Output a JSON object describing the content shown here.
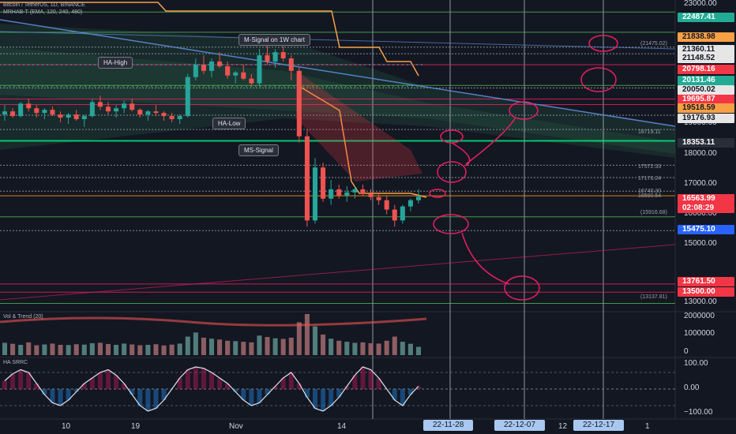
{
  "main_pane": {
    "symbol_line": "Bitcoin / TetherUS, 1D, BINANCE",
    "indicator_line": "MRHAB-T (EMA, 120, 240, 480)"
  },
  "vol_pane": {
    "title": "Vol & Trend (20)"
  },
  "osc_pane": {
    "title": "HA SRRC"
  },
  "annotations": {
    "m_signal": "M-Signal on 1W chart",
    "ha_high": "HA-High",
    "ha_low": "HA-Low",
    "ms_signal": "MS-Signal"
  },
  "line_labels": [
    {
      "text": "(21475.02)"
    },
    {
      "text": "18719.11"
    },
    {
      "text": "17572.33"
    },
    {
      "text": "17176.24"
    },
    {
      "text": "16740.30"
    },
    {
      "text": "16590.54"
    },
    {
      "text": "(15916.68)"
    },
    {
      "text": "(13137.81)"
    }
  ],
  "price_axis": {
    "ticks": [
      "23000.00",
      "19000.00",
      "18000.00",
      "17000.00",
      "16000.00",
      "15000.00",
      "13000.00"
    ],
    "badges": [
      {
        "text": "22487.41",
        "bg": "#22ab94",
        "fg": "#ffffff"
      },
      {
        "text": "21838.98",
        "bg": "#f7a046",
        "fg": "#131722"
      },
      {
        "text": "21360.11",
        "bg": "#e6e6e6",
        "fg": "#131722"
      },
      {
        "text": "21148.52",
        "bg": "#e6e6e6",
        "fg": "#131722"
      },
      {
        "text": "20798.16",
        "bg": "#f23645",
        "fg": "#ffffff"
      },
      {
        "text": "20131.46",
        "bg": "#22ab94",
        "fg": "#ffffff"
      },
      {
        "text": "20050.02",
        "bg": "#e6e6e6",
        "fg": "#131722"
      },
      {
        "text": "19695.87",
        "bg": "#f23645",
        "fg": "#ffffff"
      },
      {
        "text": "19518.59",
        "bg": "#f7a046",
        "fg": "#131722"
      },
      {
        "text": "19176.93",
        "bg": "#e6e6e6",
        "fg": "#131722"
      },
      {
        "text": "18353.11",
        "bg": "#2a2e39",
        "fg": "#ffffff"
      },
      {
        "text": "16563.99",
        "bg": "#f23645",
        "fg": "#ffffff"
      },
      {
        "text": "02:08:29",
        "bg": "#f23645",
        "fg": "#ffffff"
      },
      {
        "text": "15475.10",
        "bg": "#2962ff",
        "fg": "#ffffff"
      },
      {
        "text": "13761.50",
        "bg": "#f23645",
        "fg": "#ffffff"
      },
      {
        "text": "13500.00",
        "bg": "#f23645",
        "fg": "#ffffff"
      }
    ]
  },
  "vol_axis": {
    "ticks": [
      "2000000",
      "1000000",
      "0"
    ]
  },
  "osc_axis": {
    "ticks": [
      "100.00",
      "0.00",
      "−100.00"
    ]
  },
  "time_axis": {
    "ticks": [
      "10",
      "19",
      "Nov",
      "14",
      "12",
      "1"
    ],
    "highlighted": [
      "22-11-28",
      "22-12-07",
      "22-12-17"
    ]
  },
  "chart_data": {
    "type": "candlestick",
    "symbol": "Bitcoin / TetherUS",
    "interval": "1D",
    "last_price": 16563.99,
    "countdown": "02:08:29",
    "y_range": [
      13000,
      23000
    ],
    "candles": [
      [
        19200,
        19500,
        19000,
        19300
      ],
      [
        19300,
        19400,
        19100,
        19150
      ],
      [
        19150,
        19600,
        19100,
        19550
      ],
      [
        19550,
        19700,
        19300,
        19400
      ],
      [
        19400,
        19500,
        19100,
        19250
      ],
      [
        19250,
        19400,
        19050,
        19350
      ],
      [
        19350,
        19450,
        19150,
        19200
      ],
      [
        19200,
        19300,
        18950,
        19100
      ],
      [
        19100,
        19250,
        18900,
        19200
      ],
      [
        19200,
        19350,
        19000,
        19050
      ],
      [
        19050,
        19200,
        18800,
        19150
      ],
      [
        19150,
        19700,
        19100,
        19600
      ],
      [
        19600,
        19800,
        19350,
        19450
      ],
      [
        19450,
        19600,
        19200,
        19300
      ],
      [
        19300,
        19500,
        19100,
        19400
      ],
      [
        19400,
        19650,
        19250,
        19550
      ],
      [
        19550,
        19700,
        19300,
        19350
      ],
      [
        19350,
        19400,
        19100,
        19200
      ],
      [
        19200,
        19350,
        19000,
        19300
      ],
      [
        19300,
        19500,
        19150,
        19250
      ],
      [
        19250,
        19300,
        19000,
        19150
      ],
      [
        19150,
        19250,
        18950,
        19050
      ],
      [
        19050,
        19200,
        18900,
        19150
      ],
      [
        19150,
        20500,
        19100,
        20400
      ],
      [
        20400,
        21000,
        20300,
        20800
      ],
      [
        20800,
        21100,
        20500,
        20600
      ],
      [
        20600,
        21000,
        20400,
        20900
      ],
      [
        20900,
        21200,
        20700,
        20750
      ],
      [
        20750,
        20900,
        20350,
        20450
      ],
      [
        20450,
        20600,
        20200,
        20550
      ],
      [
        20550,
        20800,
        20300,
        20350
      ],
      [
        20350,
        20500,
        20100,
        20200
      ],
      [
        20200,
        21300,
        20100,
        21100
      ],
      [
        21100,
        21450,
        20800,
        20900
      ],
      [
        20900,
        21300,
        20700,
        21200
      ],
      [
        21200,
        21400,
        20900,
        21000
      ],
      [
        21000,
        21100,
        20300,
        20600
      ],
      [
        20600,
        20700,
        18300,
        18500
      ],
      [
        18500,
        18700,
        15600,
        15800
      ],
      [
        15800,
        17800,
        15700,
        17500
      ],
      [
        17500,
        17650,
        16400,
        16500
      ],
      [
        16500,
        17100,
        16300,
        16800
      ],
      [
        16800,
        16950,
        16500,
        16600
      ],
      [
        16600,
        16900,
        16400,
        16700
      ],
      [
        16700,
        16900,
        16500,
        16800
      ],
      [
        16800,
        16950,
        16600,
        16650
      ],
      [
        16650,
        16800,
        16450,
        16550
      ],
      [
        16550,
        16700,
        16300,
        16450
      ],
      [
        16450,
        16600,
        16000,
        16150
      ],
      [
        16150,
        16300,
        15600,
        15800
      ],
      [
        15800,
        16300,
        15700,
        16250
      ],
      [
        16250,
        16500,
        16100,
        16450
      ],
      [
        16450,
        16800,
        16350,
        16564
      ]
    ],
    "levels": [
      22487.41,
      21838.98,
      21360.11,
      21148.52,
      20798.16,
      20131.46,
      20050.02,
      19695.87,
      19518.59,
      19176.93,
      18719.11,
      18353.11,
      17572.33,
      17176.24,
      16740.3,
      16590.54,
      15916.68,
      15475.1,
      13761.5,
      13500.0,
      13137.81
    ],
    "volume_range": [
      0,
      2000000
    ],
    "volume": [
      600000,
      550000,
      500000,
      620000,
      480000,
      520000,
      560000,
      500000,
      490000,
      530000,
      510000,
      580000,
      600000,
      540000,
      500000,
      560000,
      520000,
      480000,
      500000,
      530000,
      470000,
      510000,
      560000,
      900000,
      1100000,
      850000,
      800000,
      760000,
      700000,
      680000,
      650000,
      620000,
      950000,
      880000,
      820000,
      790000,
      850000,
      1600000,
      2000000,
      1400000,
      1000000,
      800000,
      700000,
      650000,
      600000,
      620000,
      580000,
      560000,
      700000,
      900000,
      650000,
      550000,
      400000
    ],
    "oscillator_range": [
      -100,
      100
    ],
    "oscillator": [
      30,
      55,
      70,
      60,
      20,
      -20,
      -50,
      -60,
      -40,
      -10,
      20,
      40,
      60,
      70,
      50,
      20,
      -20,
      -60,
      -80,
      -70,
      -40,
      0,
      40,
      70,
      80,
      75,
      60,
      40,
      20,
      -10,
      -40,
      -60,
      -50,
      -20,
      10,
      40,
      60,
      20,
      -30,
      -70,
      -80,
      -60,
      -30,
      10,
      50,
      80,
      70,
      40,
      0,
      -40,
      -60,
      -20,
      10
    ]
  }
}
